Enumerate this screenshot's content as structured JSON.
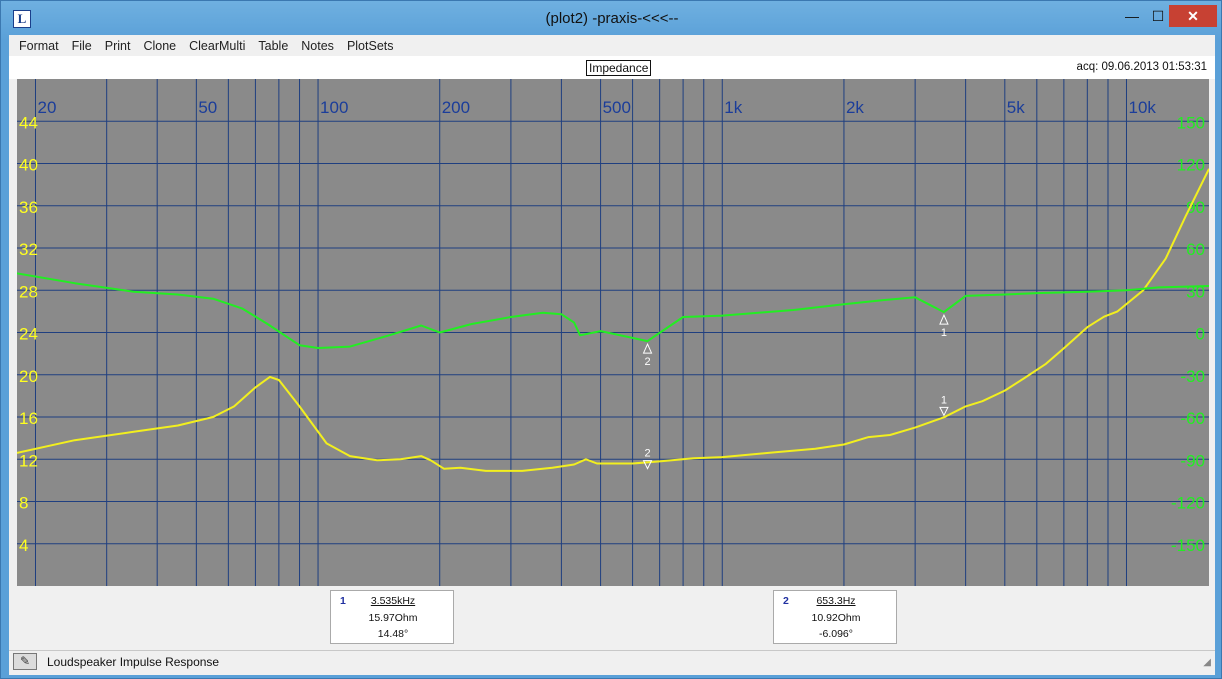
{
  "window": {
    "title": "(plot2) -praxis-<<<--",
    "app_icon": "L",
    "min_label": "—",
    "max_label": "☐",
    "close_label": "✕"
  },
  "menu": [
    "Format",
    "File",
    "Print",
    "Clone",
    "ClearMulti",
    "Table",
    "Notes",
    "PlotSets"
  ],
  "plot": {
    "title": "Impedance",
    "acq": "acq: 09.06.2013 01:53:31"
  },
  "chart_data": {
    "type": "line",
    "x_scale": "log",
    "xlim": [
      18,
      16000
    ],
    "x_tick_labels": [
      {
        "value": 20,
        "label": "20"
      },
      {
        "value": 50,
        "label": "50"
      },
      {
        "value": 100,
        "label": "100"
      },
      {
        "value": 200,
        "label": "200"
      },
      {
        "value": 500,
        "label": "500"
      },
      {
        "value": 1000,
        "label": "1k"
      },
      {
        "value": 2000,
        "label": "2k"
      },
      {
        "value": 5000,
        "label": "5k"
      },
      {
        "value": 10000,
        "label": "10k"
      }
    ],
    "x_gridlines": [
      20,
      30,
      40,
      50,
      60,
      70,
      80,
      90,
      100,
      200,
      300,
      400,
      500,
      600,
      700,
      800,
      900,
      1000,
      2000,
      3000,
      4000,
      5000,
      6000,
      7000,
      8000,
      9000,
      10000
    ],
    "ylim_left": [
      0,
      48
    ],
    "y_left_ticks": [
      4,
      8,
      12,
      16,
      20,
      24,
      28,
      32,
      36,
      40,
      44
    ],
    "ylim_right": [
      -180,
      180
    ],
    "y_right_ticks": [
      -150,
      -120,
      -90,
      -60,
      -30,
      0,
      30,
      60,
      90,
      120,
      150
    ],
    "grid": true,
    "colors": {
      "background": "#8a8a8a",
      "grid": "#1f3f80",
      "x_labels": "#1b3d9a",
      "left_labels": "#ffff20",
      "right_labels": "#22ee22"
    },
    "series": [
      {
        "axis": "left",
        "color": "#f2ef1e",
        "points": [
          [
            18,
            12.6
          ],
          [
            25,
            13.8
          ],
          [
            35,
            14.6
          ],
          [
            45,
            15.2
          ],
          [
            55,
            16.0
          ],
          [
            62,
            17.0
          ],
          [
            70,
            18.8
          ],
          [
            76,
            19.8
          ],
          [
            80,
            19.5
          ],
          [
            90,
            17.0
          ],
          [
            105,
            13.5
          ],
          [
            120,
            12.3
          ],
          [
            140,
            11.9
          ],
          [
            160,
            12.0
          ],
          [
            180,
            12.3
          ],
          [
            190,
            11.9
          ],
          [
            205,
            11.1
          ],
          [
            225,
            11.2
          ],
          [
            260,
            10.9
          ],
          [
            320,
            10.9
          ],
          [
            380,
            11.2
          ],
          [
            430,
            11.5
          ],
          [
            460,
            12.0
          ],
          [
            490,
            11.6
          ],
          [
            520,
            11.6
          ],
          [
            600,
            11.6
          ],
          [
            700,
            11.8
          ],
          [
            850,
            12.1
          ],
          [
            1000,
            12.2
          ],
          [
            1300,
            12.6
          ],
          [
            1700,
            13.0
          ],
          [
            2000,
            13.4
          ],
          [
            2300,
            14.1
          ],
          [
            2600,
            14.3
          ],
          [
            3000,
            15.0
          ],
          [
            3535,
            15.97
          ],
          [
            4000,
            17.0
          ],
          [
            4400,
            17.5
          ],
          [
            5000,
            18.5
          ],
          [
            5600,
            19.7
          ],
          [
            6300,
            21.0
          ],
          [
            7000,
            22.5
          ],
          [
            8000,
            24.5
          ],
          [
            8800,
            25.5
          ],
          [
            9500,
            26.0
          ],
          [
            11000,
            28.0
          ],
          [
            12500,
            31.0
          ],
          [
            14000,
            35.0
          ],
          [
            16000,
            39.5
          ]
        ]
      },
      {
        "axis": "right",
        "color": "#22ee22",
        "points": [
          [
            18,
            42
          ],
          [
            25,
            35
          ],
          [
            35,
            29
          ],
          [
            45,
            27
          ],
          [
            55,
            24
          ],
          [
            65,
            17
          ],
          [
            75,
            6
          ],
          [
            90,
            -9
          ],
          [
            100,
            -11
          ],
          [
            120,
            -10
          ],
          [
            150,
            -2
          ],
          [
            180,
            5
          ],
          [
            200,
            0
          ],
          [
            240,
            6
          ],
          [
            300,
            11
          ],
          [
            360,
            14
          ],
          [
            400,
            13
          ],
          [
            430,
            7
          ],
          [
            445,
            -2
          ],
          [
            500,
            1
          ],
          [
            653.3,
            -6.096
          ],
          [
            800,
            11
          ],
          [
            1000,
            12
          ],
          [
            1500,
            16
          ],
          [
            2000,
            20
          ],
          [
            2500,
            23
          ],
          [
            3000,
            25
          ],
          [
            3535,
            14.48
          ],
          [
            4000,
            26
          ],
          [
            5000,
            27
          ],
          [
            6000,
            28
          ],
          [
            8000,
            29
          ],
          [
            10000,
            30
          ],
          [
            12000,
            32
          ],
          [
            16000,
            33
          ]
        ]
      }
    ],
    "markers": [
      {
        "id": "1",
        "freq": 3535,
        "ohm": 15.97,
        "deg": 14.48
      },
      {
        "id": "2",
        "freq": 653.3,
        "ohm": 10.92,
        "deg": -6.096
      }
    ]
  },
  "marker_panels": [
    {
      "num": "1",
      "freq": "3.535kHz",
      "ohm": "15.97Ohm",
      "deg": "14.48°"
    },
    {
      "num": "2",
      "freq": "653.3Hz",
      "ohm": "10.92Ohm",
      "deg": "-6.096°"
    }
  ],
  "status": {
    "icon": "pencil-icon",
    "icon_glyph": "✎",
    "text": "Loudspeaker Impulse Response"
  }
}
